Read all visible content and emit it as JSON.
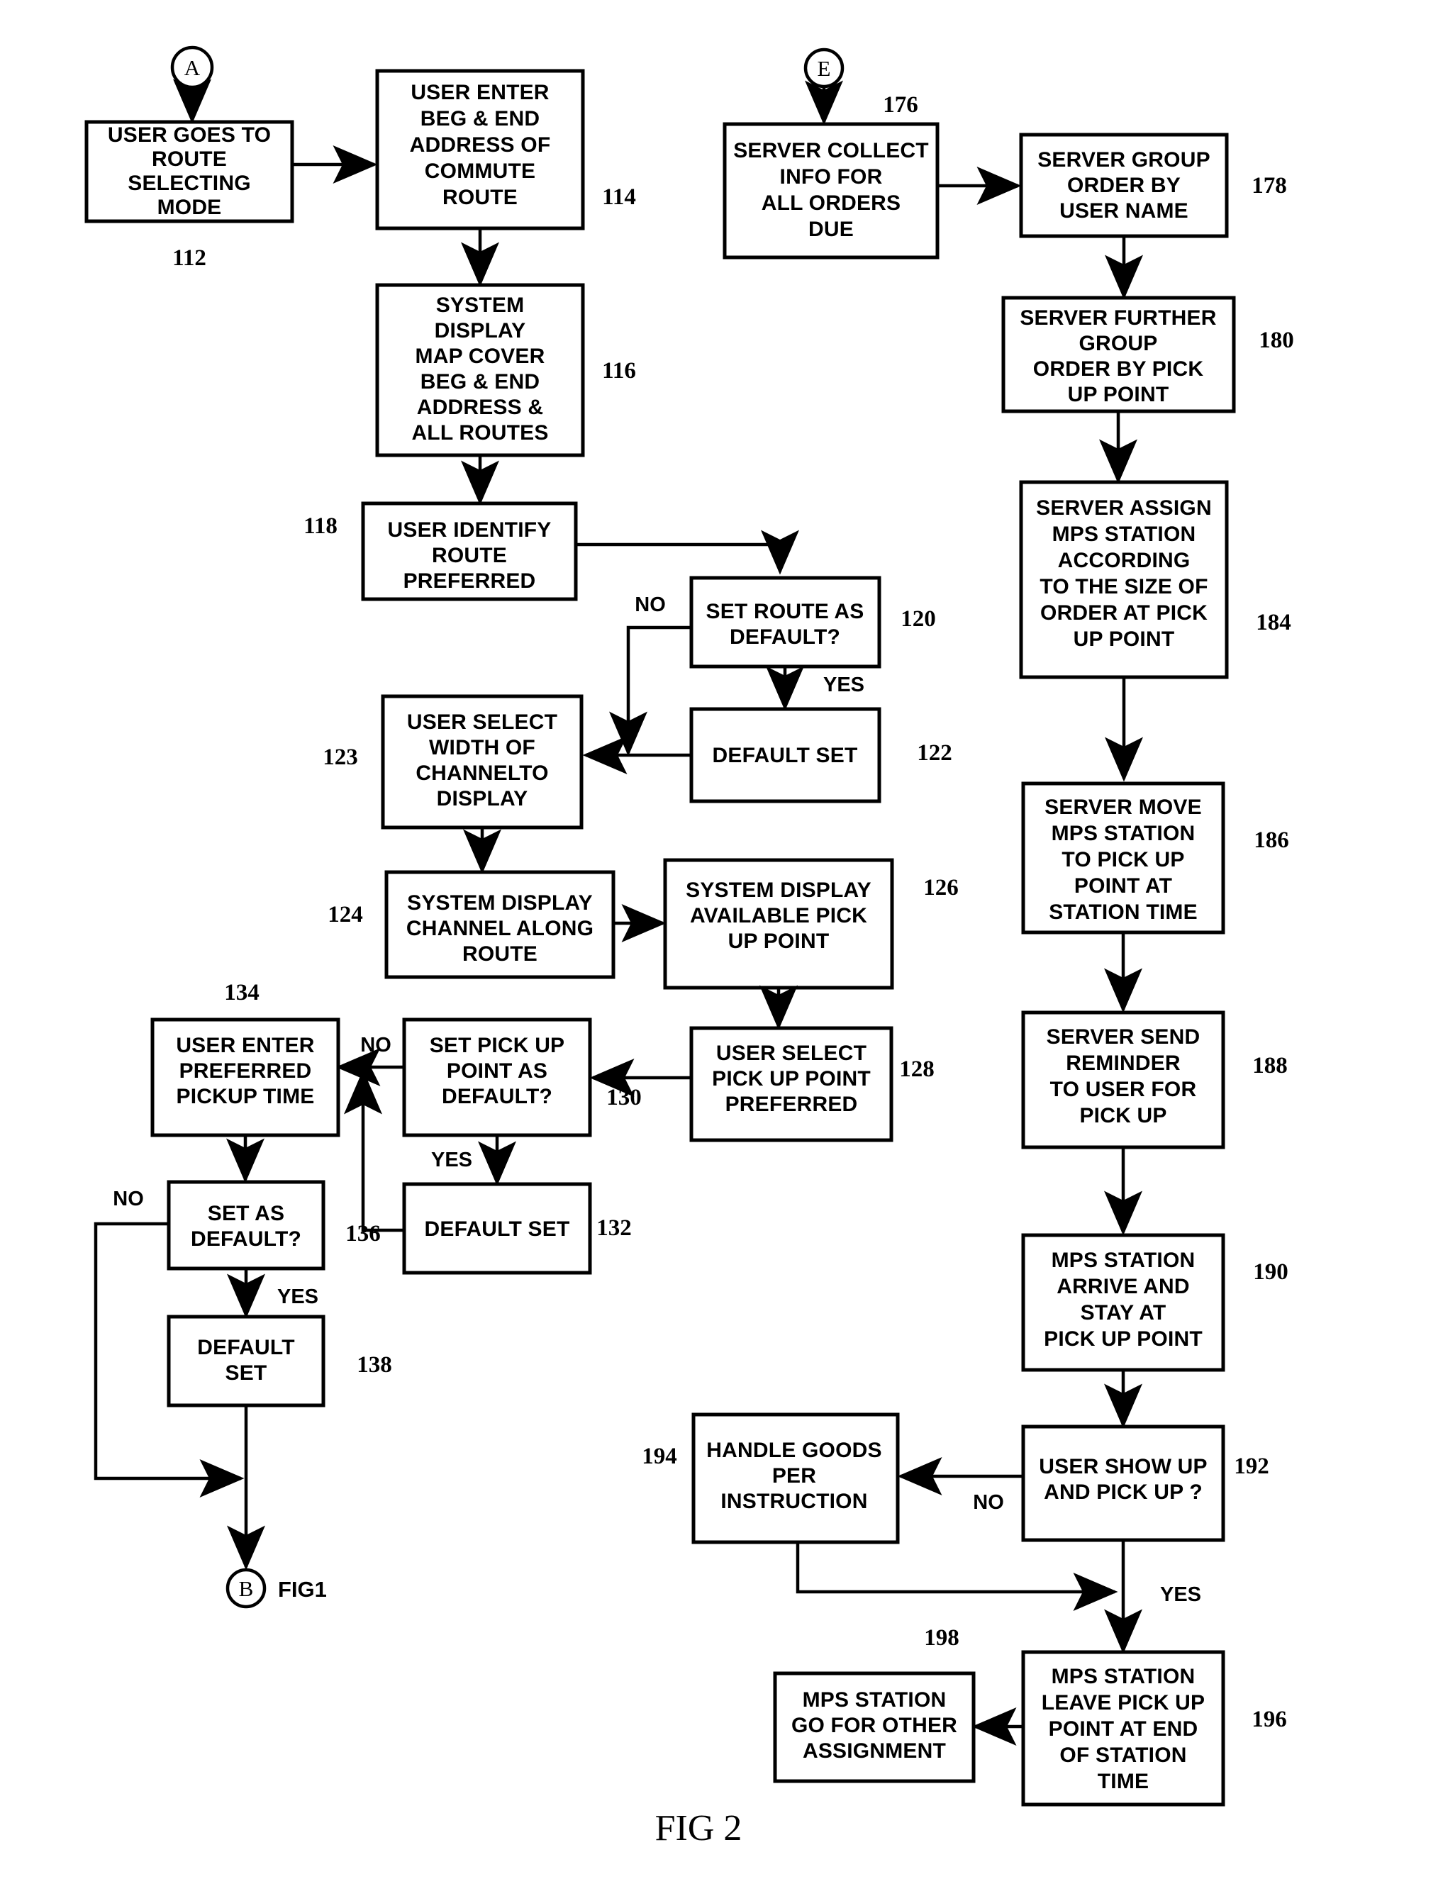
{
  "figure": {
    "caption": "FIG 2",
    "type": "flowchart"
  },
  "connectors": {
    "a": {
      "letter": "A"
    },
    "e": {
      "letter": "E"
    },
    "b": {
      "letter": "B",
      "note": "FIG1"
    }
  },
  "boxes": {
    "b112": {
      "ref": "112",
      "lines": [
        "USER GOES TO",
        "ROUTE",
        "SELECTING",
        "MODE"
      ]
    },
    "b114": {
      "ref": "114",
      "lines": [
        "USER ENTER",
        "BEG & END",
        "ADDRESS OF",
        "COMMUTE",
        "ROUTE"
      ]
    },
    "b116": {
      "ref": "116",
      "lines": [
        "SYSTEM",
        "DISPLAY",
        "MAP COVER",
        "BEG & END",
        "ADDRESS &",
        "ALL ROUTES"
      ]
    },
    "b118": {
      "ref": "118",
      "lines": [
        "USER IDENTIFY",
        "ROUTE",
        "PREFERRED"
      ]
    },
    "b120": {
      "ref": "120",
      "lines": [
        "SET ROUTE AS",
        "DEFAULT?"
      ]
    },
    "b122": {
      "ref": "122",
      "lines": [
        "DEFAULT  SET"
      ]
    },
    "b123": {
      "ref": "123",
      "lines": [
        "USER SELECT",
        "WIDTH OF",
        "CHANNELTO",
        "DISPLAY"
      ]
    },
    "b124": {
      "ref": "124",
      "lines": [
        "SYSTEM DISPLAY",
        "CHANNEL ALONG",
        "ROUTE"
      ]
    },
    "b126": {
      "ref": "126",
      "lines": [
        "SYSTEM DISPLAY",
        "AVAILABLE PICK",
        "UP POINT"
      ]
    },
    "b128": {
      "ref": "128",
      "lines": [
        "USER SELECT",
        "PICK UP  POINT",
        "PREFERRED"
      ]
    },
    "b130": {
      "ref": "130",
      "lines": [
        "SET PICK UP",
        "POINT AS",
        "DEFAULT?"
      ]
    },
    "b132": {
      "ref": "132",
      "lines": [
        "DEFAULT  SET"
      ]
    },
    "b134": {
      "ref": "134",
      "lines": [
        "USER ENTER",
        "PREFERRED",
        "PICKUP TIME"
      ]
    },
    "b136": {
      "ref": "136",
      "lines": [
        "SET AS",
        "DEFAULT?"
      ]
    },
    "b138": {
      "ref": "138",
      "lines": [
        "DEFAULT",
        "SET"
      ]
    },
    "b176": {
      "ref": "176",
      "lines": [
        "SERVER COLLECT",
        "INFO FOR",
        "ALL ORDERS",
        "DUE"
      ]
    },
    "b178": {
      "ref": "178",
      "lines": [
        "SERVER GROUP",
        "ORDER BY",
        "USER NAME"
      ]
    },
    "b180": {
      "ref": "180",
      "lines": [
        "SERVER FURTHER",
        "GROUP",
        "ORDER BY PICK",
        "UP POINT"
      ]
    },
    "b184": {
      "ref": "184",
      "lines": [
        "SERVER ASSIGN",
        "MPS STATION",
        "ACCORDING",
        "TO THE SIZE OF",
        "ORDER AT  PICK",
        "UP POINT"
      ]
    },
    "b186": {
      "ref": "186",
      "lines": [
        "SERVER MOVE",
        "MPS STATION",
        "TO PICK UP",
        "POINT AT",
        "STATION TIME"
      ]
    },
    "b188": {
      "ref": "188",
      "lines": [
        "SERVER SEND",
        "REMINDER",
        "TO USER FOR",
        "PICK UP"
      ]
    },
    "b190": {
      "ref": "190",
      "lines": [
        "MPS STATION",
        "ARRIVE AND",
        "STAY AT",
        "PICK UP POINT"
      ]
    },
    "b192": {
      "ref": "192",
      "lines": [
        "USER SHOW UP",
        "AND PICK UP ?"
      ]
    },
    "b194": {
      "ref": "194",
      "lines": [
        "HANDLE GOODS",
        "PER",
        "INSTRUCTION"
      ]
    },
    "b196": {
      "ref": "196",
      "lines": [
        "MPS STATION",
        "LEAVE PICK UP",
        "POINT AT END",
        "OF STATION",
        "TIME"
      ]
    },
    "b198": {
      "ref": "198",
      "lines": [
        "MPS STATION",
        "GO FOR OTHER",
        "ASSIGNMENT"
      ]
    }
  },
  "edge_labels": {
    "no_120": "NO",
    "yes_120": "YES",
    "no_130": "NO",
    "yes_130": "YES",
    "no_136": "NO",
    "yes_136": "YES",
    "no_192": "NO",
    "yes_192": "YES"
  },
  "colors": {
    "ink": "#000000",
    "paper": "#ffffff"
  }
}
